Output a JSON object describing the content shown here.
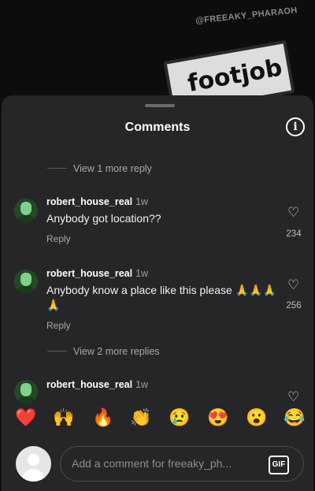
{
  "background": {
    "watermark": "@FREEAKY_PHARAOH",
    "sign_text": "footjob"
  },
  "sheet": {
    "title": "Comments"
  },
  "thread_top": {
    "view_more": "View 1 more reply"
  },
  "comments": [
    {
      "username": "robert_house_real",
      "time": "1w",
      "text": "Anybody got location??",
      "reply_label": "Reply",
      "likes": "234"
    },
    {
      "username": "robert_house_real",
      "time": "1w",
      "text": "Anybody know a place like this please 🙏🙏🙏🙏",
      "reply_label": "Reply",
      "likes": "256",
      "view_more": "View 2 more replies"
    },
    {
      "username": "robert_house_real",
      "time": "1w"
    }
  ],
  "emoji_bar": [
    "❤️",
    "🙌",
    "🔥",
    "👏",
    "😢",
    "😍",
    "😮",
    "😂"
  ],
  "composer": {
    "placeholder": "Add a comment for freeaky_ph...",
    "gif_label": "GIF"
  }
}
